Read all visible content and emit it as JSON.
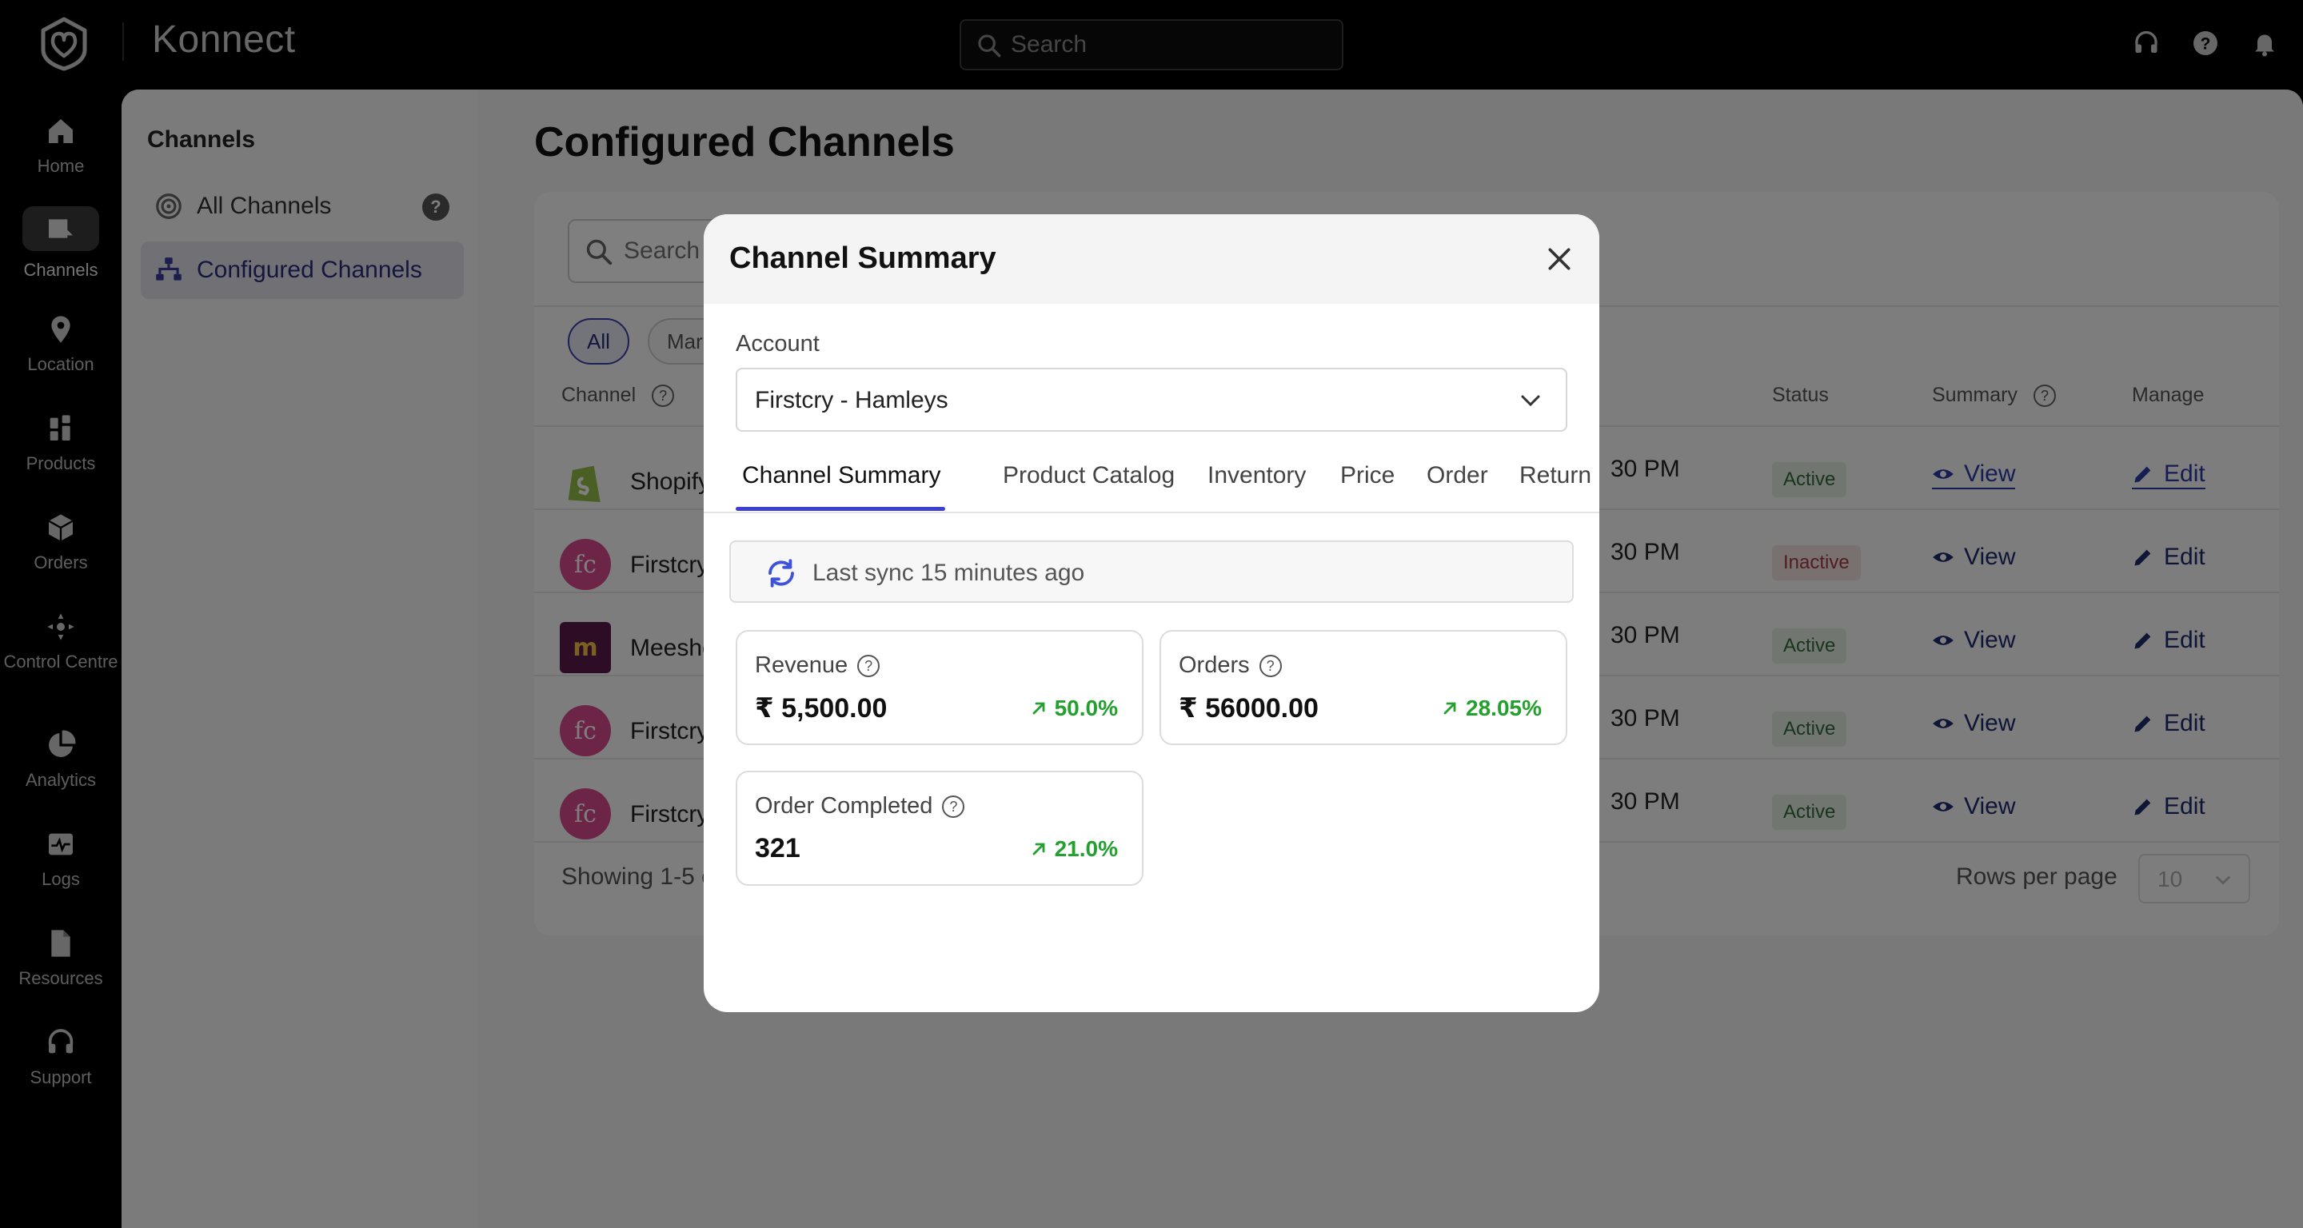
{
  "app": {
    "brand": "Konnect",
    "search_placeholder": "Search"
  },
  "top_icons": [
    "headset-icon",
    "help-icon",
    "bell-icon"
  ],
  "rail": {
    "items": [
      {
        "label": "Home",
        "icon": "home-icon"
      },
      {
        "label": "Channels",
        "icon": "channels-icon",
        "active": true
      },
      {
        "label": "Location",
        "icon": "location-pin-icon"
      },
      {
        "label": "Products",
        "icon": "products-icon"
      },
      {
        "label": "Orders",
        "icon": "orders-box-icon"
      },
      {
        "label": "Control Centre",
        "icon": "control-centre-icon"
      },
      {
        "label": "Analytics",
        "icon": "pie-chart-icon"
      },
      {
        "label": "Logs",
        "icon": "logs-icon"
      },
      {
        "label": "Resources",
        "icon": "document-icon"
      },
      {
        "label": "Support",
        "icon": "headset-icon"
      }
    ]
  },
  "subnav": {
    "heading": "Channels",
    "items": [
      {
        "label": "All Channels",
        "icon": "radar-icon",
        "help": "?"
      },
      {
        "label": "Configured Channels",
        "icon": "network-icon",
        "active": true
      }
    ]
  },
  "page": {
    "title": "Configured Channels",
    "search_placeholder": "Search b",
    "chips": [
      "All",
      "Marke"
    ],
    "columns": {
      "channel": "Channel",
      "status": "Status",
      "summary": "Summary",
      "manage": "Manage"
    },
    "rows": [
      {
        "name": "Shopify",
        "time": "30 PM",
        "status": "Active",
        "view": "View",
        "edit": "Edit",
        "logo": "shopify"
      },
      {
        "name": "Firstcry",
        "time": "30 PM",
        "status": "Inactive",
        "view": "View",
        "edit": "Edit",
        "logo": "firstcry"
      },
      {
        "name": "Meesho",
        "time": "30 PM",
        "status": "Active",
        "view": "View",
        "edit": "Edit",
        "logo": "meesho"
      },
      {
        "name": "Firstcry",
        "time": "30 PM",
        "status": "Active",
        "view": "View",
        "edit": "Edit",
        "logo": "firstcry"
      },
      {
        "name": "Firstcry",
        "time": "30 PM",
        "status": "Active",
        "view": "View",
        "edit": "Edit",
        "logo": "firstcry"
      }
    ],
    "footer_text": "Showing 1-5 of",
    "rows_per_page_label": "Rows per page",
    "rows_per_page_value": "10"
  },
  "modal": {
    "title": "Channel Summary",
    "account_label": "Account",
    "account_value": "Firstcry - Hamleys",
    "tabs": [
      "Channel Summary",
      "Product Catalog",
      "Inventory",
      "Price",
      "Order",
      "Return"
    ],
    "active_tab": "Channel Summary",
    "sync_text": "Last sync 15 minutes ago",
    "metrics": [
      {
        "label": "Revenue",
        "value": "₹ 5,500.00",
        "change": "50.0%"
      },
      {
        "label": "Orders",
        "value": "₹ 56000.00",
        "change": "28.05%"
      },
      {
        "label": "Order Completed",
        "value": "321",
        "change": "21.0%"
      }
    ]
  },
  "colors": {
    "accent": "#3c3fd0",
    "positive": "#23a02e",
    "active_badge_bg": "#e3ece3",
    "inactive_badge_bg": "#f3e1e1",
    "link": "#1f2a6e"
  }
}
